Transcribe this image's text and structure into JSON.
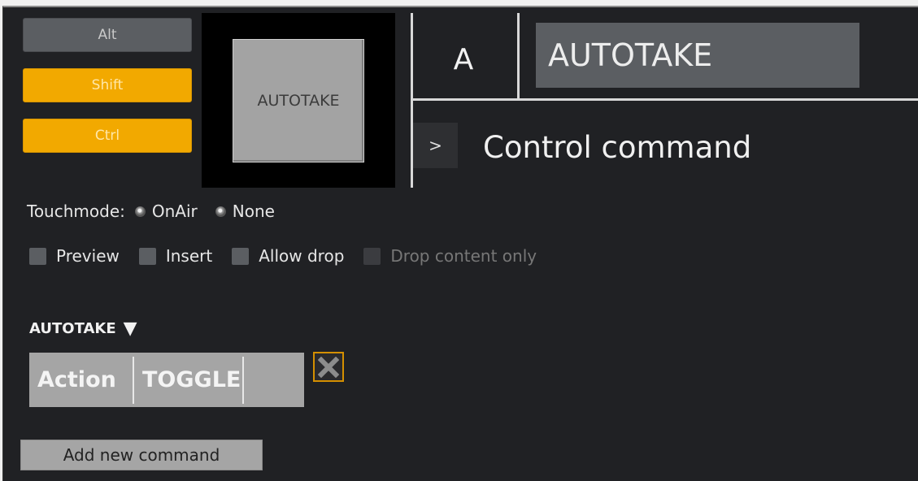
{
  "modifiers": {
    "alt": {
      "label": "Alt",
      "active": false
    },
    "shift": {
      "label": "Shift",
      "active": true
    },
    "ctrl": {
      "label": "Ctrl",
      "active": true
    }
  },
  "key_preview": {
    "label": "AUTOTAKE"
  },
  "key": {
    "letter": "A",
    "title": "AUTOTAKE"
  },
  "command_type": {
    "expand_label": ">",
    "label": "Control command"
  },
  "touchmode": {
    "label": "Touchmode:",
    "options": [
      {
        "label": "OnAir"
      },
      {
        "label": "None"
      }
    ]
  },
  "options": {
    "preview": "Preview",
    "insert": "Insert",
    "allow_drop": "Allow drop",
    "drop_content_only": "Drop content only"
  },
  "command_section": {
    "title": "AUTOTAKE",
    "toggle_glyph": "▼",
    "action_label": "Action",
    "action_value": "TOGGLE"
  },
  "add_button": "Add new command",
  "colors": {
    "accent": "#f2a900",
    "background": "#202124",
    "control": "#5b5e62"
  }
}
